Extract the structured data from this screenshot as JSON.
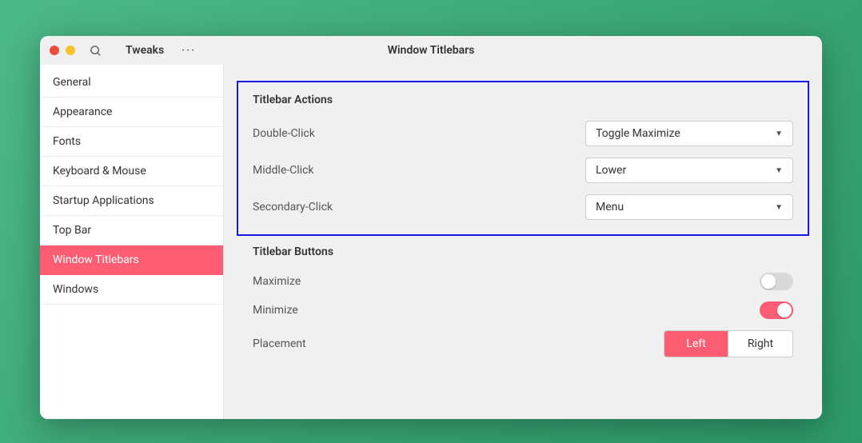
{
  "header": {
    "app_title": "Tweaks",
    "page_title": "Window Titlebars"
  },
  "sidebar": {
    "items": [
      {
        "label": "General",
        "active": false
      },
      {
        "label": "Appearance",
        "active": false
      },
      {
        "label": "Fonts",
        "active": false
      },
      {
        "label": "Keyboard & Mouse",
        "active": false
      },
      {
        "label": "Startup Applications",
        "active": false
      },
      {
        "label": "Top Bar",
        "active": false
      },
      {
        "label": "Window Titlebars",
        "active": true
      },
      {
        "label": "Windows",
        "active": false
      }
    ]
  },
  "sections": {
    "actions": {
      "title": "Titlebar Actions",
      "double_click": {
        "label": "Double-Click",
        "value": "Toggle Maximize"
      },
      "middle_click": {
        "label": "Middle-Click",
        "value": "Lower"
      },
      "secondary_click": {
        "label": "Secondary-Click",
        "value": "Menu"
      }
    },
    "buttons": {
      "title": "Titlebar Buttons",
      "maximize": {
        "label": "Maximize",
        "on": false
      },
      "minimize": {
        "label": "Minimize",
        "on": true
      },
      "placement": {
        "label": "Placement",
        "left": "Left",
        "right": "Right",
        "selected": "left"
      }
    }
  }
}
